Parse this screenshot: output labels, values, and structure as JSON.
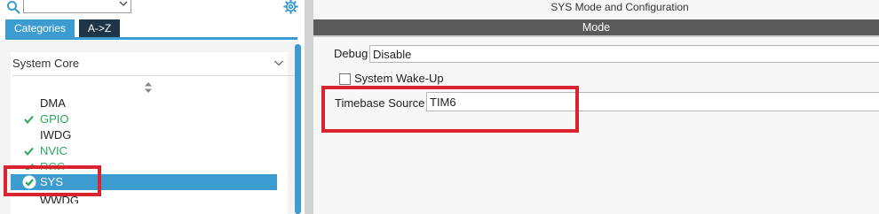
{
  "left_panel": {
    "search": {
      "value": "",
      "placeholder": ""
    },
    "tabs": {
      "categories": "Categories",
      "az": "A->Z"
    },
    "category": "System Core",
    "items": [
      {
        "label": "DMA",
        "status": "none"
      },
      {
        "label": "GPIO",
        "status": "configured"
      },
      {
        "label": "IWDG",
        "status": "none"
      },
      {
        "label": "NVIC",
        "status": "configured"
      },
      {
        "label": "RCC",
        "status": "configured"
      },
      {
        "label": "SYS",
        "status": "selected"
      },
      {
        "label": "WWDG",
        "status": "none"
      }
    ]
  },
  "right_panel": {
    "title": "SYS Mode and Configuration",
    "mode_header": "Mode",
    "debug": {
      "label": "Debug",
      "value": "Disable"
    },
    "wakeup": {
      "label": "System Wake-Up",
      "checked": false
    },
    "timebase": {
      "label": "Timebase Source",
      "value": "TIM6"
    }
  },
  "colors": {
    "accent": "#3c9ccf",
    "tab_dark": "#1f3546",
    "configured_green": "#2aa55f",
    "highlight_red": "#d9232e",
    "mode_bar": "#5a5a5a"
  },
  "icons": [
    "search-icon",
    "chevron-down-icon",
    "gear-icon",
    "sort-icon",
    "check-icon",
    "check-circle-icon"
  ]
}
